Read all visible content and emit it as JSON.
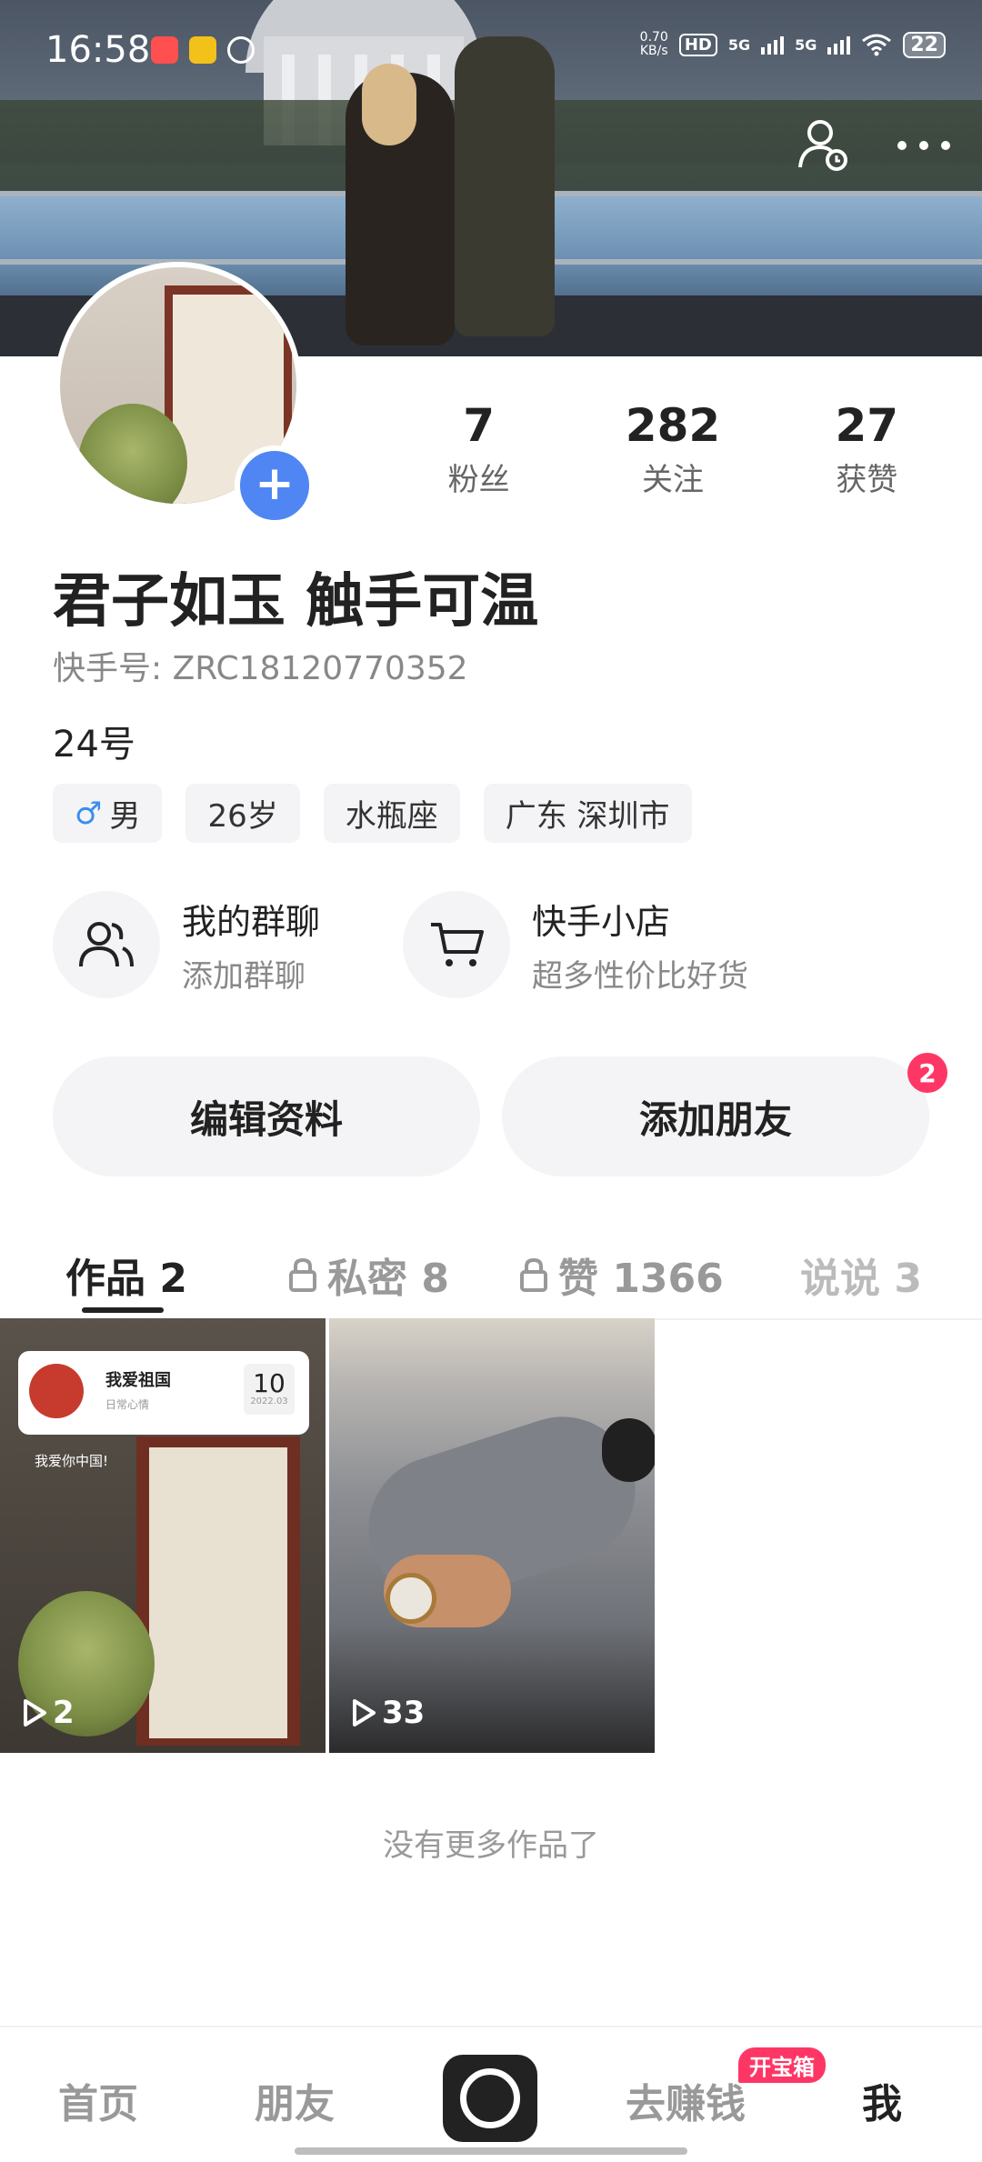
{
  "status_bar": {
    "time": "16:58",
    "speed_value": "0.70",
    "speed_unit": "KB/s",
    "hd": "HD",
    "net1": "5G",
    "net2": "5G",
    "battery": "22"
  },
  "profile": {
    "stats": [
      {
        "value": "7",
        "label": "粉丝"
      },
      {
        "value": "282",
        "label": "关注"
      },
      {
        "value": "27",
        "label": "获赞"
      }
    ],
    "nickname": "君子如玉 触手可温",
    "kuaishou_id": "快手号: ZRC18120770352",
    "bio": "24号",
    "tags": {
      "gender": "男",
      "age": "26岁",
      "zodiac": "水瓶座",
      "location": "广东 深圳市"
    }
  },
  "features": [
    {
      "title": "我的群聊",
      "subtitle": "添加群聊",
      "icon": "group-icon"
    },
    {
      "title": "快手小店",
      "subtitle": "超多性价比好货",
      "icon": "cart-icon"
    }
  ],
  "actions": {
    "edit_label": "编辑资料",
    "add_friend_label": "添加朋友",
    "add_friend_badge": "2"
  },
  "tabs": {
    "works": "作品 2",
    "private": "私密 8",
    "likes": "赞 1366",
    "talk": "说说 3"
  },
  "works": [
    {
      "card_title": "我爱祖国",
      "card_subtitle": "日常心情",
      "card_day": "10",
      "card_month": "2022.03",
      "caption": "我爱你中国!",
      "plays": "2"
    },
    {
      "plays": "33"
    }
  ],
  "no_more": "没有更多作品了",
  "bottom_nav": {
    "home": "首页",
    "friends": "朋友",
    "earn": "去赚钱",
    "earn_badge": "开宝箱",
    "me": "我"
  },
  "colors": {
    "accent_blue": "#4f86f4",
    "badge_red": "#fe3666"
  }
}
